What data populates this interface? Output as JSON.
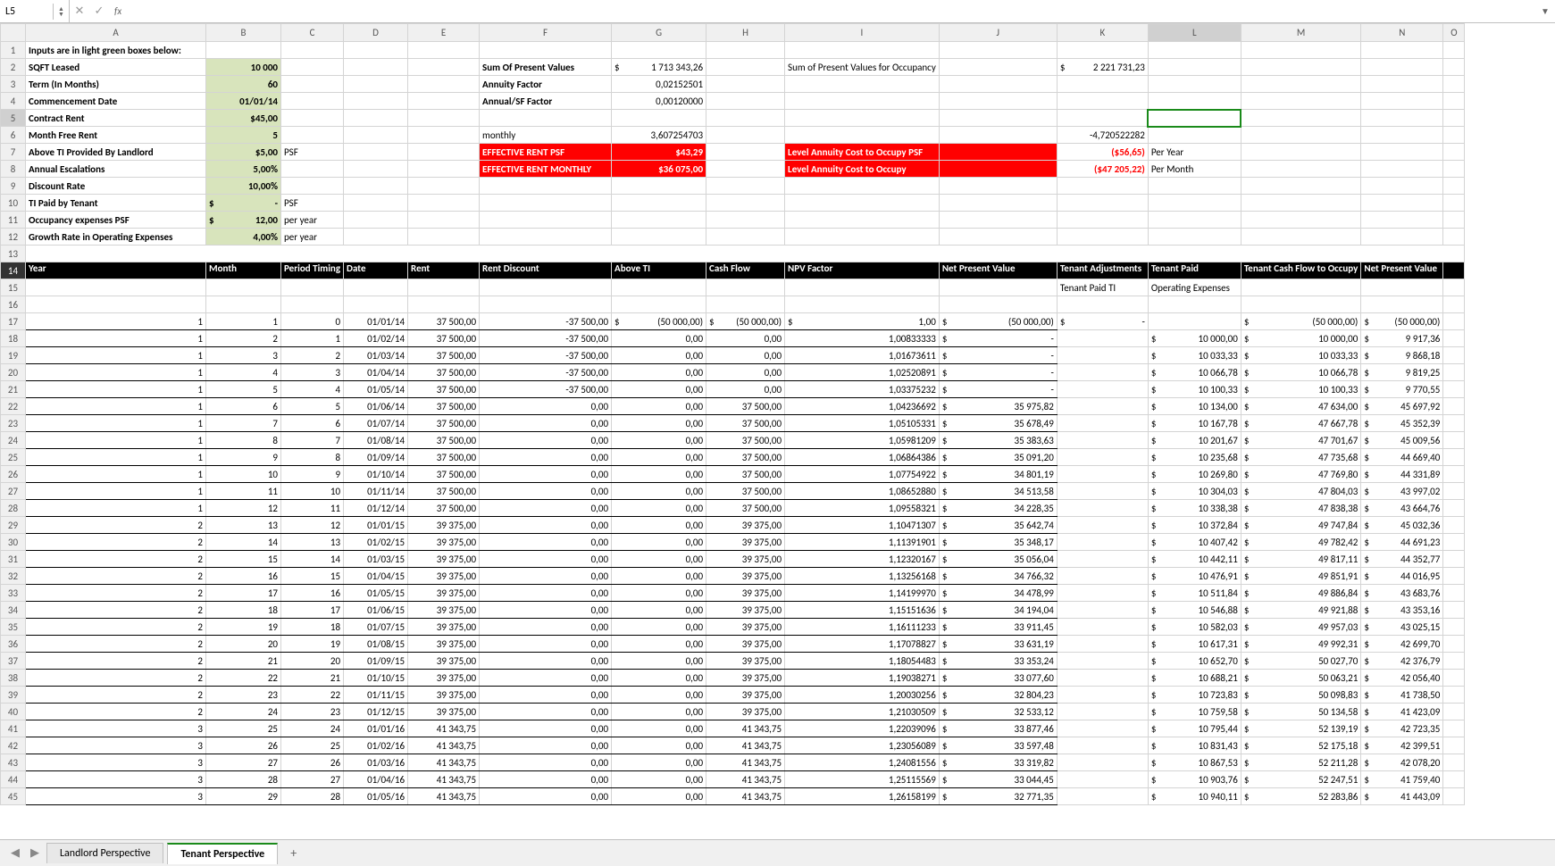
{
  "formula_bar": {
    "cell_ref": "L5",
    "fx": "fx",
    "value": ""
  },
  "columns": [
    "A",
    "B",
    "C",
    "D",
    "E",
    "F",
    "G",
    "H",
    "I",
    "J",
    "K",
    "L",
    "M",
    "N",
    "O"
  ],
  "inputs_title": "Inputs are in light green boxes below:",
  "inputs": {
    "sqft_label": "SQFT Leased",
    "sqft": "10 000",
    "term_label": "Term (In Months)",
    "term": "60",
    "comm_label": "Commencement Date",
    "comm": "01/01/14",
    "rent_label": "Contract Rent",
    "rent": "$45,00",
    "free_label": "Month Free Rent",
    "free": "5",
    "ti_ll_label": "Above TI Provided By Landlord",
    "ti_ll": "$5,00",
    "psf": "PSF",
    "esc_label": "Annual Escalations",
    "esc": "5,00%",
    "disc_label": "Discount Rate",
    "disc": "10,00%",
    "ti_t_label": "TI Paid by Tenant",
    "ti_t": "-",
    "ti_t_prefix": "$",
    "ti_t_unit": "PSF",
    "occ_label": "Occupancy expenses PSF",
    "occ": "12,00",
    "occ_prefix": "$",
    "occ_unit": "per year",
    "grow_label": "Growth Rate in Operating Expenses",
    "grow": "4,00%",
    "grow_unit": "per year"
  },
  "summary": {
    "spv_label": "Sum Of Present Values",
    "spv_sym": "$",
    "spv": "1 713 343,26",
    "af_label": "Annuity Factor",
    "af": "0,02152501",
    "asf_label": "Annual/SF Factor",
    "asf": "0,00120000",
    "monthly_label": "monthly",
    "monthly": "3,607254703",
    "erp_label": "EFFECTIVE RENT PSF",
    "erp": "$43,29",
    "erm_label": "EFFECTIVE RENT MONTHLY",
    "erm": "$36 075,00",
    "occ_spv_label": "Sum of Present Values for Occupancy",
    "occ_spv_sym": "$",
    "occ_spv": "2 221 731,23",
    "neg_misc": "-4,720522282",
    "lac_psf_label": "Level Annuity Cost to Occupy PSF",
    "lac_psf": "($56,65)",
    "py": "Per Year",
    "lac_label": "Level Annuity Cost to Occupy",
    "lac": "($47 205,22)",
    "pm": "Per Month"
  },
  "headers": {
    "year": "Year",
    "month": "Month",
    "period": "Period Timing",
    "date": "Date",
    "rent": "Rent",
    "disc": "Rent Discount",
    "ti": "Above TI",
    "cf": "Cash Flow",
    "npvf": "NPV Factor",
    "npv": "Net Present Value",
    "tadj": "Tenant Adjustments",
    "tpaid": "Tenant Paid",
    "tcf": "Tenant Cash Flow to Occupy",
    "npv2": "Net Present Value",
    "sub_tpti": "Tenant Paid TI",
    "sub_oe": "Operating Expenses"
  },
  "rows": [
    {
      "r": 17,
      "y": "1",
      "m": "1",
      "p": "0",
      "d": "01/01/14",
      "rent": "37 500,00",
      "rd": "-37 500,00",
      "ti_s": "$",
      "ti": "(50 000,00)",
      "cf_s": "$",
      "cf": "(50 000,00)",
      "nf_s": "$",
      "nf": "1,00",
      "npv_s": "$",
      "npv": "(50 000,00)",
      "ta_s": "$",
      "ta": "-",
      "tp_s": "",
      "tp": "",
      "tcf_s": "$",
      "tcf": "(50 000,00)",
      "n2_s": "$",
      "n2": "(50 000,00)"
    },
    {
      "r": 18,
      "y": "1",
      "m": "2",
      "p": "1",
      "d": "01/02/14",
      "rent": "37 500,00",
      "rd": "-37 500,00",
      "ti_s": "",
      "ti": "0,00",
      "cf_s": "",
      "cf": "0,00",
      "nf_s": "",
      "nf": "1,00833333",
      "npv_s": "$",
      "npv": "-",
      "ta_s": "",
      "ta": "",
      "tp_s": "$",
      "tp": "10 000,00",
      "tcf_s": "$",
      "tcf": "10 000,00",
      "n2_s": "$",
      "n2": "9 917,36"
    },
    {
      "r": 19,
      "y": "1",
      "m": "3",
      "p": "2",
      "d": "01/03/14",
      "rent": "37 500,00",
      "rd": "-37 500,00",
      "ti_s": "",
      "ti": "0,00",
      "cf_s": "",
      "cf": "0,00",
      "nf_s": "",
      "nf": "1,01673611",
      "npv_s": "$",
      "npv": "-",
      "ta_s": "",
      "ta": "",
      "tp_s": "$",
      "tp": "10 033,33",
      "tcf_s": "$",
      "tcf": "10 033,33",
      "n2_s": "$",
      "n2": "9 868,18"
    },
    {
      "r": 20,
      "y": "1",
      "m": "4",
      "p": "3",
      "d": "01/04/14",
      "rent": "37 500,00",
      "rd": "-37 500,00",
      "ti_s": "",
      "ti": "0,00",
      "cf_s": "",
      "cf": "0,00",
      "nf_s": "",
      "nf": "1,02520891",
      "npv_s": "$",
      "npv": "-",
      "ta_s": "",
      "ta": "",
      "tp_s": "$",
      "tp": "10 066,78",
      "tcf_s": "$",
      "tcf": "10 066,78",
      "n2_s": "$",
      "n2": "9 819,25"
    },
    {
      "r": 21,
      "y": "1",
      "m": "5",
      "p": "4",
      "d": "01/05/14",
      "rent": "37 500,00",
      "rd": "-37 500,00",
      "ti_s": "",
      "ti": "0,00",
      "cf_s": "",
      "cf": "0,00",
      "nf_s": "",
      "nf": "1,03375232",
      "npv_s": "$",
      "npv": "-",
      "ta_s": "",
      "ta": "",
      "tp_s": "$",
      "tp": "10 100,33",
      "tcf_s": "$",
      "tcf": "10 100,33",
      "n2_s": "$",
      "n2": "9 770,55"
    },
    {
      "r": 22,
      "y": "1",
      "m": "6",
      "p": "5",
      "d": "01/06/14",
      "rent": "37 500,00",
      "rd": "0,00",
      "ti_s": "",
      "ti": "0,00",
      "cf_s": "",
      "cf": "37 500,00",
      "nf_s": "",
      "nf": "1,04236692",
      "npv_s": "$",
      "npv": "35 975,82",
      "ta_s": "",
      "ta": "",
      "tp_s": "$",
      "tp": "10 134,00",
      "tcf_s": "$",
      "tcf": "47 634,00",
      "n2_s": "$",
      "n2": "45 697,92"
    },
    {
      "r": 23,
      "y": "1",
      "m": "7",
      "p": "6",
      "d": "01/07/14",
      "rent": "37 500,00",
      "rd": "0,00",
      "ti_s": "",
      "ti": "0,00",
      "cf_s": "",
      "cf": "37 500,00",
      "nf_s": "",
      "nf": "1,05105331",
      "npv_s": "$",
      "npv": "35 678,49",
      "ta_s": "",
      "ta": "",
      "tp_s": "$",
      "tp": "10 167,78",
      "tcf_s": "$",
      "tcf": "47 667,78",
      "n2_s": "$",
      "n2": "45 352,39"
    },
    {
      "r": 24,
      "y": "1",
      "m": "8",
      "p": "7",
      "d": "01/08/14",
      "rent": "37 500,00",
      "rd": "0,00",
      "ti_s": "",
      "ti": "0,00",
      "cf_s": "",
      "cf": "37 500,00",
      "nf_s": "",
      "nf": "1,05981209",
      "npv_s": "$",
      "npv": "35 383,63",
      "ta_s": "",
      "ta": "",
      "tp_s": "$",
      "tp": "10 201,67",
      "tcf_s": "$",
      "tcf": "47 701,67",
      "n2_s": "$",
      "n2": "45 009,56"
    },
    {
      "r": 25,
      "y": "1",
      "m": "9",
      "p": "8",
      "d": "01/09/14",
      "rent": "37 500,00",
      "rd": "0,00",
      "ti_s": "",
      "ti": "0,00",
      "cf_s": "",
      "cf": "37 500,00",
      "nf_s": "",
      "nf": "1,06864386",
      "npv_s": "$",
      "npv": "35 091,20",
      "ta_s": "",
      "ta": "",
      "tp_s": "$",
      "tp": "10 235,68",
      "tcf_s": "$",
      "tcf": "47 735,68",
      "n2_s": "$",
      "n2": "44 669,40"
    },
    {
      "r": 26,
      "y": "1",
      "m": "10",
      "p": "9",
      "d": "01/10/14",
      "rent": "37 500,00",
      "rd": "0,00",
      "ti_s": "",
      "ti": "0,00",
      "cf_s": "",
      "cf": "37 500,00",
      "nf_s": "",
      "nf": "1,07754922",
      "npv_s": "$",
      "npv": "34 801,19",
      "ta_s": "",
      "ta": "",
      "tp_s": "$",
      "tp": "10 269,80",
      "tcf_s": "$",
      "tcf": "47 769,80",
      "n2_s": "$",
      "n2": "44 331,89"
    },
    {
      "r": 27,
      "y": "1",
      "m": "11",
      "p": "10",
      "d": "01/11/14",
      "rent": "37 500,00",
      "rd": "0,00",
      "ti_s": "",
      "ti": "0,00",
      "cf_s": "",
      "cf": "37 500,00",
      "nf_s": "",
      "nf": "1,08652880",
      "npv_s": "$",
      "npv": "34 513,58",
      "ta_s": "",
      "ta": "",
      "tp_s": "$",
      "tp": "10 304,03",
      "tcf_s": "$",
      "tcf": "47 804,03",
      "n2_s": "$",
      "n2": "43 997,02"
    },
    {
      "r": 28,
      "y": "1",
      "m": "12",
      "p": "11",
      "d": "01/12/14",
      "rent": "37 500,00",
      "rd": "0,00",
      "ti_s": "",
      "ti": "0,00",
      "cf_s": "",
      "cf": "37 500,00",
      "nf_s": "",
      "nf": "1,09558321",
      "npv_s": "$",
      "npv": "34 228,35",
      "ta_s": "",
      "ta": "",
      "tp_s": "$",
      "tp": "10 338,38",
      "tcf_s": "$",
      "tcf": "47 838,38",
      "n2_s": "$",
      "n2": "43 664,76"
    },
    {
      "r": 29,
      "y": "2",
      "m": "13",
      "p": "12",
      "d": "01/01/15",
      "rent": "39 375,00",
      "rd": "0,00",
      "ti_s": "",
      "ti": "0,00",
      "cf_s": "",
      "cf": "39 375,00",
      "nf_s": "",
      "nf": "1,10471307",
      "npv_s": "$",
      "npv": "35 642,74",
      "ta_s": "",
      "ta": "",
      "tp_s": "$",
      "tp": "10 372,84",
      "tcf_s": "$",
      "tcf": "49 747,84",
      "n2_s": "$",
      "n2": "45 032,36"
    },
    {
      "r": 30,
      "y": "2",
      "m": "14",
      "p": "13",
      "d": "01/02/15",
      "rent": "39 375,00",
      "rd": "0,00",
      "ti_s": "",
      "ti": "0,00",
      "cf_s": "",
      "cf": "39 375,00",
      "nf_s": "",
      "nf": "1,11391901",
      "npv_s": "$",
      "npv": "35 348,17",
      "ta_s": "",
      "ta": "",
      "tp_s": "$",
      "tp": "10 407,42",
      "tcf_s": "$",
      "tcf": "49 782,42",
      "n2_s": "$",
      "n2": "44 691,23"
    },
    {
      "r": 31,
      "y": "2",
      "m": "15",
      "p": "14",
      "d": "01/03/15",
      "rent": "39 375,00",
      "rd": "0,00",
      "ti_s": "",
      "ti": "0,00",
      "cf_s": "",
      "cf": "39 375,00",
      "nf_s": "",
      "nf": "1,12320167",
      "npv_s": "$",
      "npv": "35 056,04",
      "ta_s": "",
      "ta": "",
      "tp_s": "$",
      "tp": "10 442,11",
      "tcf_s": "$",
      "tcf": "49 817,11",
      "n2_s": "$",
      "n2": "44 352,77"
    },
    {
      "r": 32,
      "y": "2",
      "m": "16",
      "p": "15",
      "d": "01/04/15",
      "rent": "39 375,00",
      "rd": "0,00",
      "ti_s": "",
      "ti": "0,00",
      "cf_s": "",
      "cf": "39 375,00",
      "nf_s": "",
      "nf": "1,13256168",
      "npv_s": "$",
      "npv": "34 766,32",
      "ta_s": "",
      "ta": "",
      "tp_s": "$",
      "tp": "10 476,91",
      "tcf_s": "$",
      "tcf": "49 851,91",
      "n2_s": "$",
      "n2": "44 016,95"
    },
    {
      "r": 33,
      "y": "2",
      "m": "17",
      "p": "16",
      "d": "01/05/15",
      "rent": "39 375,00",
      "rd": "0,00",
      "ti_s": "",
      "ti": "0,00",
      "cf_s": "",
      "cf": "39 375,00",
      "nf_s": "",
      "nf": "1,14199970",
      "npv_s": "$",
      "npv": "34 478,99",
      "ta_s": "",
      "ta": "",
      "tp_s": "$",
      "tp": "10 511,84",
      "tcf_s": "$",
      "tcf": "49 886,84",
      "n2_s": "$",
      "n2": "43 683,76"
    },
    {
      "r": 34,
      "y": "2",
      "m": "18",
      "p": "17",
      "d": "01/06/15",
      "rent": "39 375,00",
      "rd": "0,00",
      "ti_s": "",
      "ti": "0,00",
      "cf_s": "",
      "cf": "39 375,00",
      "nf_s": "",
      "nf": "1,15151636",
      "npv_s": "$",
      "npv": "34 194,04",
      "ta_s": "",
      "ta": "",
      "tp_s": "$",
      "tp": "10 546,88",
      "tcf_s": "$",
      "tcf": "49 921,88",
      "n2_s": "$",
      "n2": "43 353,16"
    },
    {
      "r": 35,
      "y": "2",
      "m": "19",
      "p": "18",
      "d": "01/07/15",
      "rent": "39 375,00",
      "rd": "0,00",
      "ti_s": "",
      "ti": "0,00",
      "cf_s": "",
      "cf": "39 375,00",
      "nf_s": "",
      "nf": "1,16111233",
      "npv_s": "$",
      "npv": "33 911,45",
      "ta_s": "",
      "ta": "",
      "tp_s": "$",
      "tp": "10 582,03",
      "tcf_s": "$",
      "tcf": "49 957,03",
      "n2_s": "$",
      "n2": "43 025,15"
    },
    {
      "r": 36,
      "y": "2",
      "m": "20",
      "p": "19",
      "d": "01/08/15",
      "rent": "39 375,00",
      "rd": "0,00",
      "ti_s": "",
      "ti": "0,00",
      "cf_s": "",
      "cf": "39 375,00",
      "nf_s": "",
      "nf": "1,17078827",
      "npv_s": "$",
      "npv": "33 631,19",
      "ta_s": "",
      "ta": "",
      "tp_s": "$",
      "tp": "10 617,31",
      "tcf_s": "$",
      "tcf": "49 992,31",
      "n2_s": "$",
      "n2": "42 699,70"
    },
    {
      "r": 37,
      "y": "2",
      "m": "21",
      "p": "20",
      "d": "01/09/15",
      "rent": "39 375,00",
      "rd": "0,00",
      "ti_s": "",
      "ti": "0,00",
      "cf_s": "",
      "cf": "39 375,00",
      "nf_s": "",
      "nf": "1,18054483",
      "npv_s": "$",
      "npv": "33 353,24",
      "ta_s": "",
      "ta": "",
      "tp_s": "$",
      "tp": "10 652,70",
      "tcf_s": "$",
      "tcf": "50 027,70",
      "n2_s": "$",
      "n2": "42 376,79"
    },
    {
      "r": 38,
      "y": "2",
      "m": "22",
      "p": "21",
      "d": "01/10/15",
      "rent": "39 375,00",
      "rd": "0,00",
      "ti_s": "",
      "ti": "0,00",
      "cf_s": "",
      "cf": "39 375,00",
      "nf_s": "",
      "nf": "1,19038271",
      "npv_s": "$",
      "npv": "33 077,60",
      "ta_s": "",
      "ta": "",
      "tp_s": "$",
      "tp": "10 688,21",
      "tcf_s": "$",
      "tcf": "50 063,21",
      "n2_s": "$",
      "n2": "42 056,40"
    },
    {
      "r": 39,
      "y": "2",
      "m": "23",
      "p": "22",
      "d": "01/11/15",
      "rent": "39 375,00",
      "rd": "0,00",
      "ti_s": "",
      "ti": "0,00",
      "cf_s": "",
      "cf": "39 375,00",
      "nf_s": "",
      "nf": "1,20030256",
      "npv_s": "$",
      "npv": "32 804,23",
      "ta_s": "",
      "ta": "",
      "tp_s": "$",
      "tp": "10 723,83",
      "tcf_s": "$",
      "tcf": "50 098,83",
      "n2_s": "$",
      "n2": "41 738,50"
    },
    {
      "r": 40,
      "y": "2",
      "m": "24",
      "p": "23",
      "d": "01/12/15",
      "rent": "39 375,00",
      "rd": "0,00",
      "ti_s": "",
      "ti": "0,00",
      "cf_s": "",
      "cf": "39 375,00",
      "nf_s": "",
      "nf": "1,21030509",
      "npv_s": "$",
      "npv": "32 533,12",
      "ta_s": "",
      "ta": "",
      "tp_s": "$",
      "tp": "10 759,58",
      "tcf_s": "$",
      "tcf": "50 134,58",
      "n2_s": "$",
      "n2": "41 423,09"
    },
    {
      "r": 41,
      "y": "3",
      "m": "25",
      "p": "24",
      "d": "01/01/16",
      "rent": "41 343,75",
      "rd": "0,00",
      "ti_s": "",
      "ti": "0,00",
      "cf_s": "",
      "cf": "41 343,75",
      "nf_s": "",
      "nf": "1,22039096",
      "npv_s": "$",
      "npv": "33 877,46",
      "ta_s": "",
      "ta": "",
      "tp_s": "$",
      "tp": "10 795,44",
      "tcf_s": "$",
      "tcf": "52 139,19",
      "n2_s": "$",
      "n2": "42 723,35"
    },
    {
      "r": 42,
      "y": "3",
      "m": "26",
      "p": "25",
      "d": "01/02/16",
      "rent": "41 343,75",
      "rd": "0,00",
      "ti_s": "",
      "ti": "0,00",
      "cf_s": "",
      "cf": "41 343,75",
      "nf_s": "",
      "nf": "1,23056089",
      "npv_s": "$",
      "npv": "33 597,48",
      "ta_s": "",
      "ta": "",
      "tp_s": "$",
      "tp": "10 831,43",
      "tcf_s": "$",
      "tcf": "52 175,18",
      "n2_s": "$",
      "n2": "42 399,51"
    },
    {
      "r": 43,
      "y": "3",
      "m": "27",
      "p": "26",
      "d": "01/03/16",
      "rent": "41 343,75",
      "rd": "0,00",
      "ti_s": "",
      "ti": "0,00",
      "cf_s": "",
      "cf": "41 343,75",
      "nf_s": "",
      "nf": "1,24081556",
      "npv_s": "$",
      "npv": "33 319,82",
      "ta_s": "",
      "ta": "",
      "tp_s": "$",
      "tp": "10 867,53",
      "tcf_s": "$",
      "tcf": "52 211,28",
      "n2_s": "$",
      "n2": "42 078,20"
    },
    {
      "r": 44,
      "y": "3",
      "m": "28",
      "p": "27",
      "d": "01/04/16",
      "rent": "41 343,75",
      "rd": "0,00",
      "ti_s": "",
      "ti": "0,00",
      "cf_s": "",
      "cf": "41 343,75",
      "nf_s": "",
      "nf": "1,25115569",
      "npv_s": "$",
      "npv": "33 044,45",
      "ta_s": "",
      "ta": "",
      "tp_s": "$",
      "tp": "10 903,76",
      "tcf_s": "$",
      "tcf": "52 247,51",
      "n2_s": "$",
      "n2": "41 759,40"
    },
    {
      "r": 45,
      "y": "3",
      "m": "29",
      "p": "28",
      "d": "01/05/16",
      "rent": "41 343,75",
      "rd": "0,00",
      "ti_s": "",
      "ti": "0,00",
      "cf_s": "",
      "cf": "41 343,75",
      "nf_s": "",
      "nf": "1,26158199",
      "npv_s": "$",
      "npv": "32 771,35",
      "ta_s": "",
      "ta": "",
      "tp_s": "$",
      "tp": "10 940,11",
      "tcf_s": "$",
      "tcf": "52 283,86",
      "n2_s": "$",
      "n2": "41 443,09"
    }
  ],
  "tabs": {
    "t1": "Landlord Perspective",
    "t2": "Tenant Perspective"
  }
}
